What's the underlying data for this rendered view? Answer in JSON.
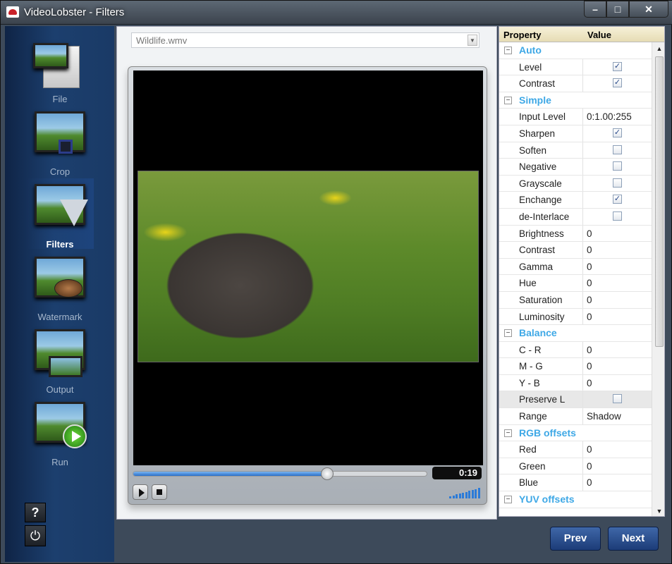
{
  "window": {
    "title": "VideoLobster - Filters",
    "min": "–",
    "max": "□",
    "close": "✕"
  },
  "sidebar": {
    "items": [
      {
        "label": "File",
        "icon": "file-icon"
      },
      {
        "label": "Crop",
        "icon": "crop-icon"
      },
      {
        "label": "Filters",
        "icon": "filters-icon",
        "active": true
      },
      {
        "label": "Watermark",
        "icon": "watermark-icon"
      },
      {
        "label": "Output",
        "icon": "output-icon"
      },
      {
        "label": "Run",
        "icon": "run-icon"
      }
    ],
    "help": "?",
    "power": "⏻"
  },
  "file_select": {
    "value": "Wildlife.wmv",
    "arrow": "▼"
  },
  "player": {
    "time": "0:19",
    "progress": 0.66
  },
  "grid": {
    "headers": {
      "property": "Property",
      "value": "Value"
    },
    "rows": [
      {
        "type": "cat",
        "name": "Auto",
        "toggle": "−"
      },
      {
        "type": "check",
        "name": "Level",
        "checked": true
      },
      {
        "type": "check",
        "name": "Contrast",
        "checked": true
      },
      {
        "type": "cat",
        "name": "Simple",
        "toggle": "−"
      },
      {
        "type": "text",
        "name": "Input Level",
        "value": "0:1.00:255"
      },
      {
        "type": "check",
        "name": "Sharpen",
        "checked": true
      },
      {
        "type": "check",
        "name": "Soften",
        "checked": false
      },
      {
        "type": "check",
        "name": "Negative",
        "checked": false
      },
      {
        "type": "check",
        "name": "Grayscale",
        "checked": false
      },
      {
        "type": "check",
        "name": "Enchange",
        "checked": true
      },
      {
        "type": "check",
        "name": "de-Interlace",
        "checked": false
      },
      {
        "type": "text",
        "name": "Brightness",
        "value": "0"
      },
      {
        "type": "text",
        "name": "Contrast",
        "value": "0"
      },
      {
        "type": "text",
        "name": "Gamma",
        "value": "0"
      },
      {
        "type": "text",
        "name": "Hue",
        "value": "0"
      },
      {
        "type": "text",
        "name": "Saturation",
        "value": "0"
      },
      {
        "type": "text",
        "name": "Luminosity",
        "value": "0"
      },
      {
        "type": "cat",
        "name": "Balance",
        "toggle": "−"
      },
      {
        "type": "text",
        "name": "C - R",
        "value": "0"
      },
      {
        "type": "text",
        "name": "M - G",
        "value": "0"
      },
      {
        "type": "text",
        "name": "Y - B",
        "value": "0"
      },
      {
        "type": "check",
        "name": "Preserve L",
        "checked": false,
        "selected": true
      },
      {
        "type": "text",
        "name": "Range",
        "value": "Shadow"
      },
      {
        "type": "cat",
        "name": "RGB offsets",
        "toggle": "−"
      },
      {
        "type": "text",
        "name": "Red",
        "value": "0"
      },
      {
        "type": "text",
        "name": "Green",
        "value": "0"
      },
      {
        "type": "text",
        "name": "Blue",
        "value": "0"
      },
      {
        "type": "cat",
        "name": "YUV offsets",
        "toggle": "−"
      }
    ],
    "scroll_up": "▲",
    "scroll_down": "▼"
  },
  "buttons": {
    "prev": "Prev",
    "next": "Next"
  }
}
